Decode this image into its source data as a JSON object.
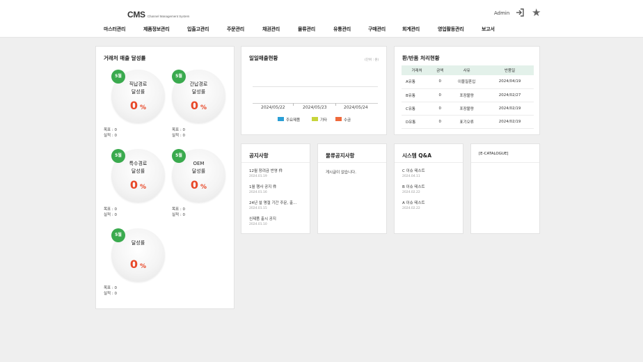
{
  "header": {
    "logo_main": "CMS",
    "logo_sub": "Channel Management System",
    "user": "Admin",
    "exit_icon": "logout-icon",
    "star_icon": "star-icon"
  },
  "menu": [
    "마스터관리",
    "제품정보관리",
    "입출고관리",
    "주문관리",
    "채권관리",
    "물류관리",
    "유통관리",
    "구매관리",
    "회계관리",
    "영업활동관리",
    "보고서"
  ],
  "achievement": {
    "title": "거래처 매출 달성률",
    "gauges": [
      {
        "badge": "5월",
        "label_1": "직납경로",
        "label_2": "달성률",
        "value": "0",
        "unit": "%",
        "target": "목표 : 0",
        "actual": "실적 : 0"
      },
      {
        "badge": "5월",
        "label_1": "간납경로",
        "label_2": "달성률",
        "value": "0",
        "unit": "%",
        "target": "목표 : 0",
        "actual": "실적 : 0"
      },
      {
        "badge": "5월",
        "label_1": "특수경로",
        "label_2": "달성률",
        "value": "0",
        "unit": "%",
        "target": "목표 : 0",
        "actual": "실적 : 0"
      },
      {
        "badge": "5월",
        "label_1": "OEM",
        "label_2": "달성률",
        "value": "0",
        "unit": "%",
        "target": "목표 : 0",
        "actual": "실적 : 0"
      },
      {
        "badge": "5월",
        "label_1": "",
        "label_2": "달성률",
        "value": "0",
        "unit": "%",
        "target": "목표 : 0",
        "actual": "실적 : 0"
      }
    ]
  },
  "daily_sales": {
    "title": "일일매출현황",
    "unit": "(단위 : 원)",
    "legend": [
      {
        "label": "주요제품",
        "color": "#2b9fd6"
      },
      {
        "label": "기타",
        "color": "#c7d53b"
      },
      {
        "label": "수금",
        "color": "#ef6a3c"
      }
    ]
  },
  "chart_data": {
    "type": "bar",
    "categories": [
      "2024/05/22",
      "2024/05/23",
      "2024/05/24"
    ],
    "series": [
      {
        "name": "주요제품",
        "values": [
          0,
          0,
          0
        ]
      },
      {
        "name": "기타",
        "values": [
          0,
          0,
          0
        ]
      },
      {
        "name": "수금",
        "values": [
          0,
          0,
          0
        ]
      }
    ],
    "legend_position": "bottom"
  },
  "returns": {
    "title": "환/반품 처리현황",
    "columns": [
      "거래처",
      "금액",
      "사유",
      "반품일"
    ],
    "rows": [
      [
        "A유통",
        "0",
        "이물질혼입",
        "2024/04/19"
      ],
      [
        "B유통",
        "0",
        "포장불량",
        "2024/02/27"
      ],
      [
        "C유통",
        "0",
        "포장불량",
        "2024/02/19"
      ],
      [
        "D유통",
        "0",
        "표기오류",
        "2024/02/19"
      ]
    ]
  },
  "notice": {
    "title": "공지사항",
    "items": [
      {
        "title": "12월 장려금 반영 件",
        "date": "2024.01.19"
      },
      {
        "title": "1월 행사 공지 件",
        "date": "2024.01.16"
      },
      {
        "title": "24년 설 명절 기간 주문, 출…",
        "date": "2024.01.15"
      },
      {
        "title": "신제품 출시 공지",
        "date": "2024.01.10"
      }
    ]
  },
  "logistics_notice": {
    "title": "물류공지사항",
    "empty": "게시글이 없습니다."
  },
  "qna": {
    "title": "시스템 Q&A",
    "items": [
      {
        "title": "C 이슈 테스트",
        "date": "2024.04.11"
      },
      {
        "title": "B 이슈 테스트",
        "date": "2024.02.22"
      },
      {
        "title": "A 이슈 테스트",
        "date": "2024.02.22"
      }
    ]
  },
  "catalogue": {
    "title": "[E-CATALOGUE]"
  }
}
